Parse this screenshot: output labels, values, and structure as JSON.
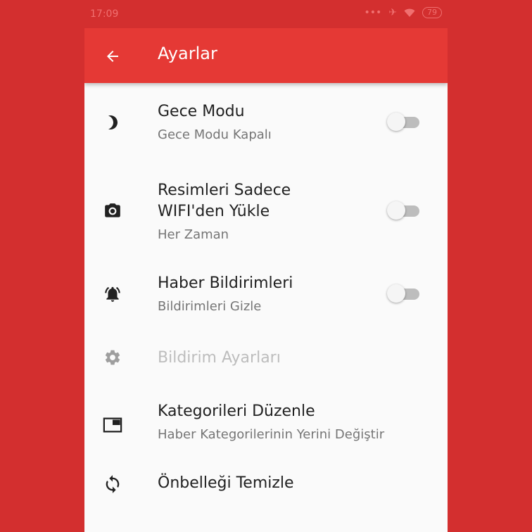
{
  "status": {
    "time": "17:09",
    "battery": "79"
  },
  "appbar": {
    "title": "Ayarlar"
  },
  "settings": [
    {
      "title": "Gece Modu",
      "subtitle": "Gece Modu Kapalı",
      "icon": "moon-icon",
      "toggle": false
    },
    {
      "title_line1": "Resimleri Sadece",
      "title_line2": "WIFI'den Yükle",
      "subtitle": "Her Zaman",
      "icon": "camera-icon",
      "toggle": false
    },
    {
      "title": "Haber Bildirimleri",
      "subtitle": "Bildirimleri Gizle",
      "icon": "bell-ringing-icon",
      "toggle": false
    },
    {
      "title": "Bildirim Ayarları",
      "icon": "gear-icon",
      "disabled": true
    },
    {
      "title": "Kategorileri Düzenle",
      "subtitle": "Haber Kategorilerinin Yerini Değiştir",
      "icon": "window-icon"
    },
    {
      "title": "Önbelleği Temizle",
      "icon": "sync-icon"
    }
  ]
}
